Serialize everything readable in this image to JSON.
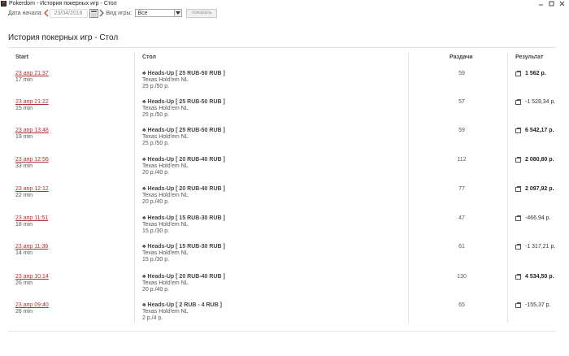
{
  "window": {
    "title": "Pokerdom - История покерных игр - Стол",
    "app_icon_glyph": "P"
  },
  "filters": {
    "date_label": "Дата начала:",
    "date_value": "23/04/2016",
    "game_label": "Вид игры:",
    "game_value": "Все",
    "show_button": "показать"
  },
  "page": {
    "title": "История покерных игр - Стол"
  },
  "columns": {
    "start": "Start",
    "table": "Стол",
    "hands": "Раздачи",
    "result": "Результат"
  },
  "rows": [
    {
      "start": "23 апр 21:37",
      "duration": "17 min",
      "table": "♣ Heads-Up [ 25 RUB-50 RUB ]",
      "game": "Texas Hold'em NL",
      "stakes": "25 р./50 р.",
      "hands": "59",
      "result": "1 562 р.",
      "positive": true
    },
    {
      "start": "23 апр 21:22",
      "duration": "15 min",
      "table": "♣ Heads-Up [ 25 RUB-50 RUB ]",
      "game": "Texas Hold'em NL",
      "stakes": "25 р./50 р.",
      "hands": "57",
      "result": "-1 528,34 р.",
      "positive": false
    },
    {
      "start": "23 апр 13:48",
      "duration": "19 min",
      "table": "♣ Heads-Up [ 25 RUB-50 RUB ]",
      "game": "Texas Hold'em NL",
      "stakes": "25 р./50 р.",
      "hands": "59",
      "result": "6 542,17 р.",
      "positive": true
    },
    {
      "start": "23 апр 12:56",
      "duration": "33 min",
      "table": "♣ Heads-Up [ 20 RUB-40 RUB ]",
      "game": "Texas Hold'em NL",
      "stakes": "20 р./40 р.",
      "hands": "112",
      "result": "2 080,80 р.",
      "positive": true
    },
    {
      "start": "23 апр 12:12",
      "duration": "22 min",
      "table": "♣ Heads-Up [ 20 RUB-40 RUB ]",
      "game": "Texas Hold'em NL",
      "stakes": "20 р./40 р.",
      "hands": "77",
      "result": "2 097,92 р.",
      "positive": true
    },
    {
      "start": "23 апр 11:51",
      "duration": "18 min",
      "table": "♣ Heads-Up [ 15 RUB-30 RUB ]",
      "game": "Texas Hold'em NL",
      "stakes": "15 р./30 р.",
      "hands": "47",
      "result": "-466,94 р.",
      "positive": false
    },
    {
      "start": "23 апр 11:36",
      "duration": "14 min",
      "table": "♣ Heads-Up [ 15 RUB-30 RUB ]",
      "game": "Texas Hold'em NL",
      "stakes": "15 р./30 р.",
      "hands": "61",
      "result": "-1 317,21 р.",
      "positive": false
    },
    {
      "start": "23 апр 10:14",
      "duration": "26 min",
      "table": "♣ Heads-Up [ 20 RUB-40 RUB ]",
      "game": "Texas Hold'em NL",
      "stakes": "20 р./40 р.",
      "hands": "130",
      "result": "4 534,50 р.",
      "positive": true
    },
    {
      "start": "23 апр 09:40",
      "duration": "26 min",
      "table": "♣ Heads-Up [ 2 RUB - 4 RUB ]",
      "game": "Texas Hold'em NL",
      "stakes": "2 р./4 р.",
      "hands": "65",
      "result": "-155,37 р.",
      "positive": false
    }
  ],
  "colors": {
    "accent_red": "#b03030",
    "link": "#b03030",
    "rule": "#e2e2e2"
  }
}
